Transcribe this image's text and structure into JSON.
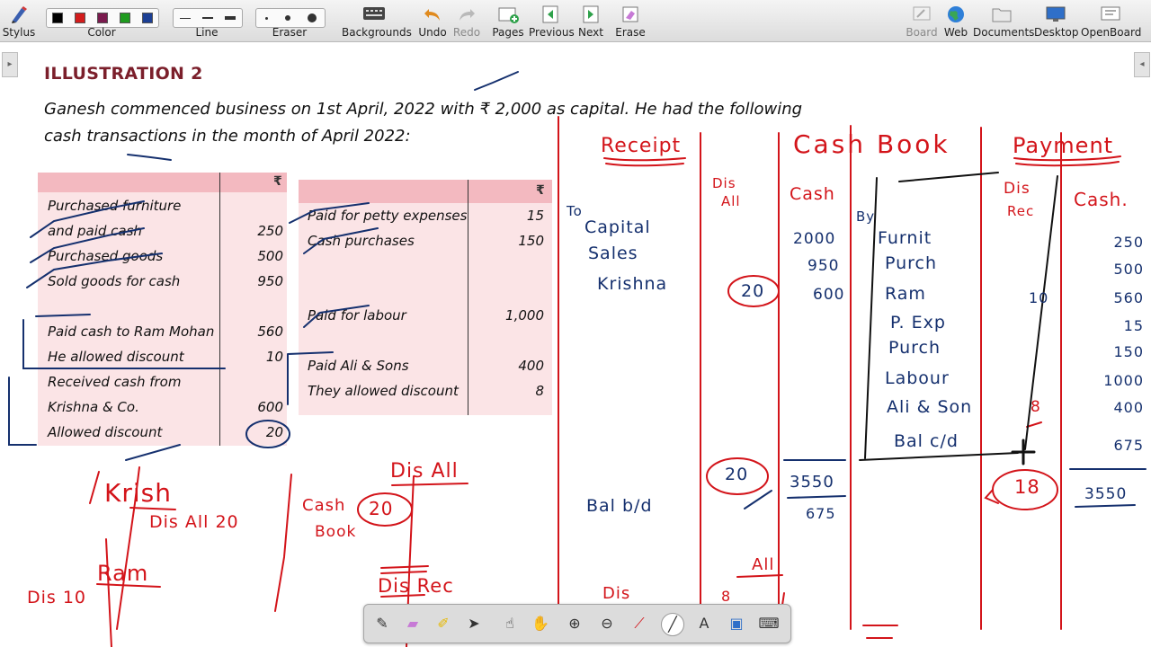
{
  "toolbar": {
    "stylus": "Stylus",
    "color": "Color",
    "line": "Line",
    "eraser": "Eraser",
    "backgrounds": "Backgrounds",
    "undo": "Undo",
    "redo": "Redo",
    "pages": "Pages",
    "previous": "Previous",
    "next": "Next",
    "erase": "Erase",
    "board": "Board",
    "web": "Web",
    "documents": "Documents",
    "desktop": "Desktop",
    "openboard": "OpenBoard",
    "colors": [
      "#000000",
      "#d31d1d",
      "#7a1b4e",
      "#1f9b1f",
      "#1c3f94"
    ]
  },
  "content": {
    "title": "ILLUSTRATION 2",
    "para_line1": "Ganesh commenced business on 1st April, 2022 with ₹ 2,000 as capital. He had the following",
    "para_line2": "cash transactions in the month of April 2022:",
    "rupee": "₹",
    "table_left": [
      {
        "text": "Purchased furniture",
        "amount": ""
      },
      {
        "text": "and paid cash",
        "amount": "250"
      },
      {
        "text": "Purchased goods",
        "amount": "500"
      },
      {
        "text": "Sold goods for cash",
        "amount": "950"
      },
      {
        "text": "Paid cash to Ram Mohan",
        "amount": "560"
      },
      {
        "text": "He allowed discount",
        "amount": "10"
      },
      {
        "text": "Received cash from",
        "amount": ""
      },
      {
        "text": "Krishna & Co.",
        "amount": "600"
      },
      {
        "text": "Allowed discount",
        "amount": "20"
      }
    ],
    "table_right": [
      {
        "text": "Paid for petty expenses",
        "amount": "15"
      },
      {
        "text": "Cash purchases",
        "amount": "150"
      },
      {
        "text": "Paid for labour",
        "amount": "1,000"
      },
      {
        "text": "Paid Ali & Sons",
        "amount": "400"
      },
      {
        "text": "They allowed discount",
        "amount": "8"
      }
    ]
  },
  "annotations": {
    "receipt": "Receipt",
    "cash_book": "Cash Book",
    "payment": "Payment",
    "dis_all": [
      "Dis",
      "All"
    ],
    "cash": "Cash",
    "cash_r": "Cash.",
    "dis_rec": [
      "Dis",
      "Rec"
    ],
    "to": "To",
    "by": "By",
    "receipts": [
      "Capital",
      "Sales",
      "Krishna"
    ],
    "receipt_amounts": [
      "2000",
      "950",
      "600"
    ],
    "receipt_disc": "20",
    "payments": [
      "Furnit",
      "Purch",
      "Ram",
      "P. Exp",
      "Purch",
      "Labour",
      "Ali & Son",
      "Bal c/d"
    ],
    "payment_amounts": [
      "250",
      "500",
      "560",
      "15",
      "150",
      "1000",
      "400",
      "675"
    ],
    "pay_disc": [
      "10",
      "8"
    ],
    "total_disc_left": "20",
    "total_left": "3550",
    "bal_bd_amount": "675",
    "total_disc_right": "18",
    "total_right": "3550",
    "bal_bd": "Bal b/d",
    "krish": "Krish",
    "krish_line": "Dis All 20",
    "ram": "Ram",
    "ram_line": "Dis 10",
    "cash_word": "Cash",
    "book_word": "Book",
    "circle_20": "20",
    "dis_all_mid": "Dis All",
    "dis_rec_mid": "Dis Rec",
    "dis_bottom": "Dis",
    "eight_bottom": "8",
    "all_bottom": "All"
  }
}
